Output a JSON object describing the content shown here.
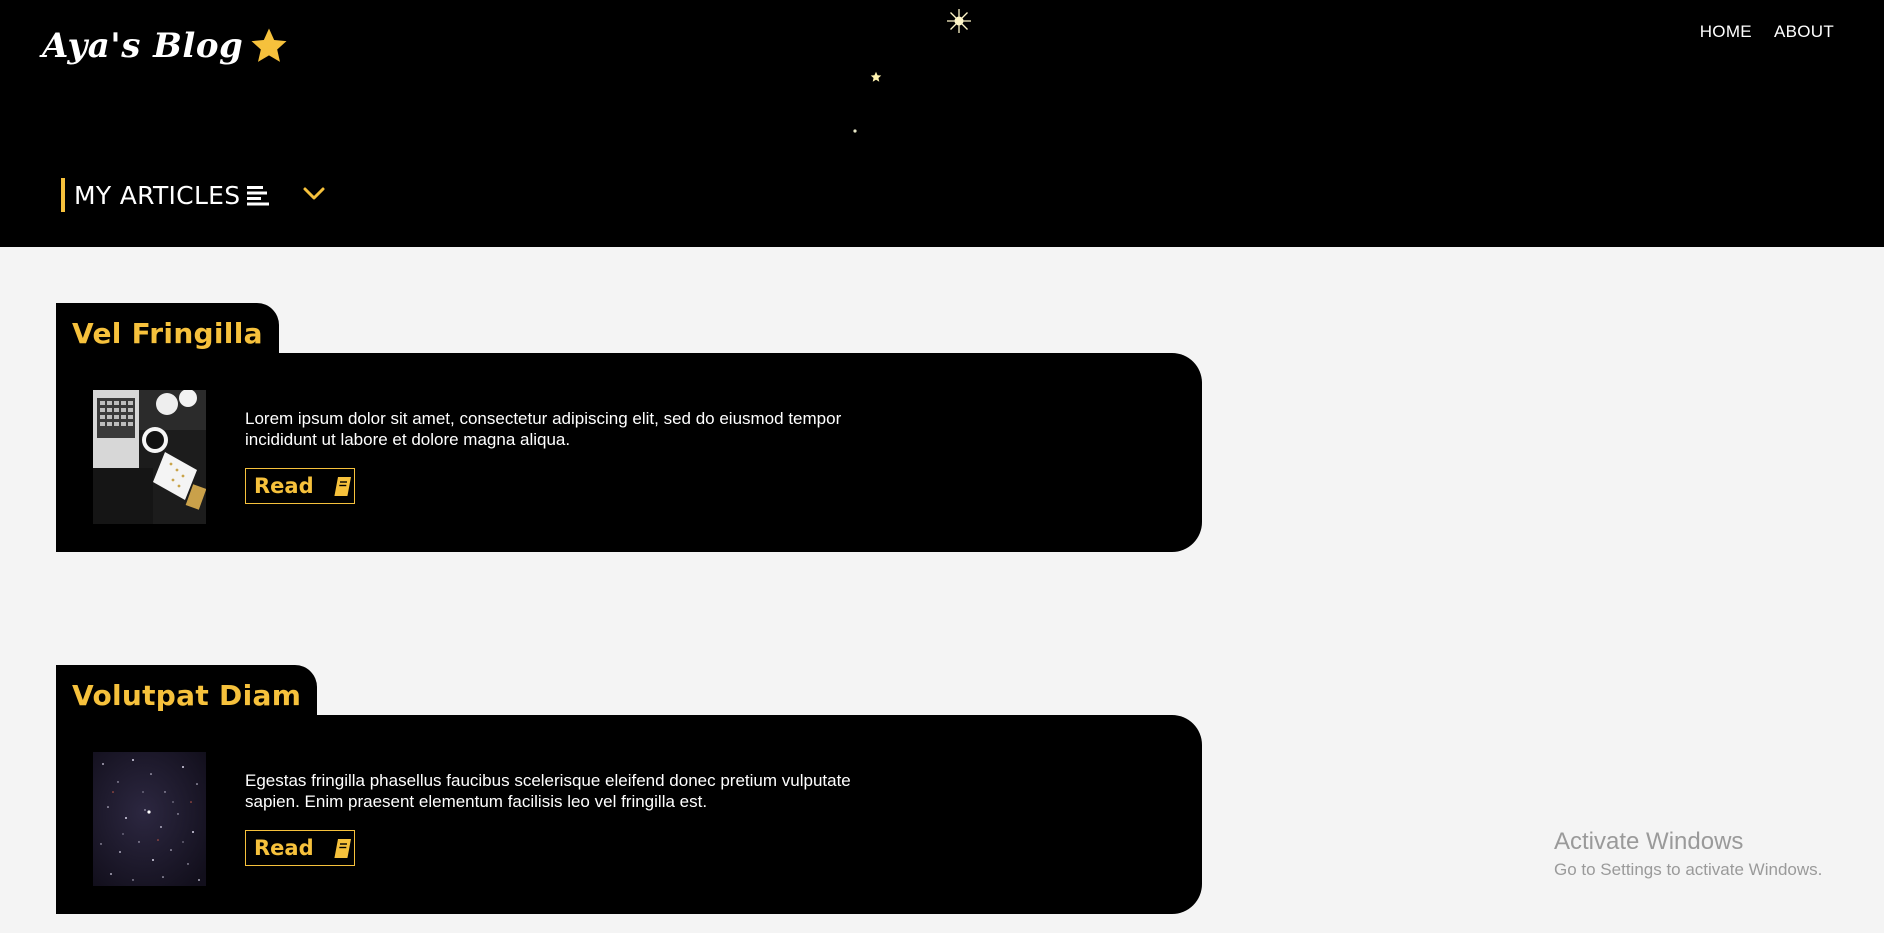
{
  "header": {
    "brand": "Aya's Blog",
    "brand_icon": "star-icon",
    "nav": [
      {
        "label": "HOME"
      },
      {
        "label": "ABOUT"
      }
    ],
    "section_title": "MY ARTICLES",
    "section_icon": "list-icon",
    "toggle_icon": "chevron-down-icon"
  },
  "articles": [
    {
      "title": "Vel Fringilla",
      "excerpt": "Lorem ipsum dolor sit amet, consectetur adipiscing elit, sed do eiusmod tempor incididunt ut labore et dolore magna aliqua.",
      "button_label": "Read",
      "button_icon": "book-icon",
      "thumbnail": "desk-laptop-coffee-image"
    },
    {
      "title": "Volutpat Diam",
      "excerpt": "Egestas fringilla phasellus faucibus scelerisque eleifend donec pretium vulputate sapien. Enim praesent elementum facilisis leo vel fringilla est.",
      "button_label": "Read",
      "button_icon": "book-icon",
      "thumbnail": "starry-sky-image"
    }
  ],
  "watermark": {
    "title": "Activate Windows",
    "subtitle": "Go to Settings to activate Windows."
  },
  "colors": {
    "accent": "#f6c13c",
    "header_bg": "#000000",
    "page_bg": "#f4f4f4",
    "card_bg": "#000000"
  }
}
